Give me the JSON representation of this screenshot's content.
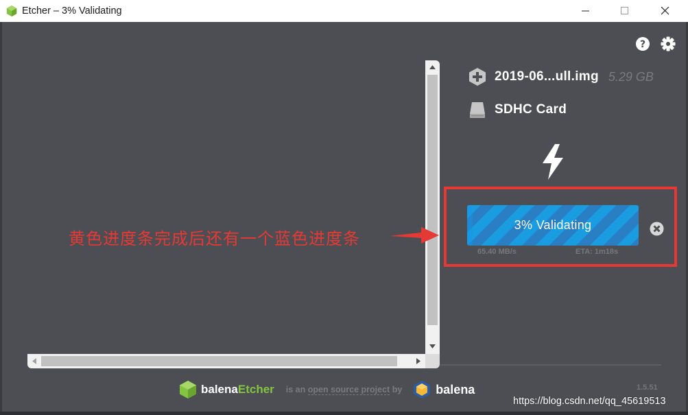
{
  "window": {
    "title": "Etcher – 3% Validating",
    "controls": [
      "minimize-icon",
      "maximize-icon",
      "close-icon"
    ]
  },
  "toolbar": {
    "help_icon": "help-icon",
    "settings_icon": "gear-icon"
  },
  "steps": {
    "image": {
      "icon": "plus-hex-icon",
      "name": "2019-06...ull.img",
      "size": "5.29 GB"
    },
    "drive": {
      "icon": "drive-icon",
      "name": "SDHC Card"
    },
    "flash": {
      "icon": "lightning-icon"
    }
  },
  "progress": {
    "label": "3% Validating",
    "percent": 3,
    "speed": "65.40 MB/s",
    "eta": "ETA: 1m18s",
    "cancel_icon": "cancel-icon"
  },
  "annotation": {
    "text": "黄色进度条完成后还有一个蓝色进度条",
    "color": "#e53935"
  },
  "footer": {
    "brand_part1": "balena",
    "brand_part2": "Etcher",
    "text_before": "is an ",
    "text_link": "open source project",
    "text_after": " by",
    "balena_word": "balena",
    "version": "1.5.51"
  },
  "watermark": "https://blog.csdn.net/qq_45619513",
  "colors": {
    "background": "#4d4e53",
    "accent_blue": "#1596e6",
    "brand_green": "#85c441",
    "annotation_red": "#e53935"
  }
}
